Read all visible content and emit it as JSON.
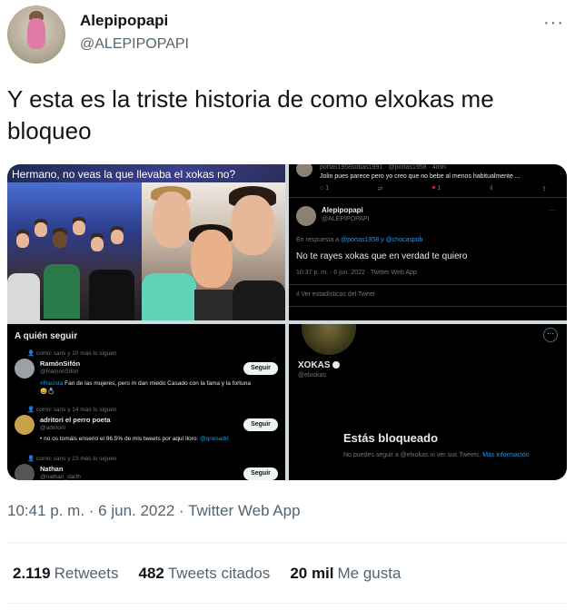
{
  "author": {
    "name": "Alepipopapi",
    "handle": "@ALEPIPOPAPI",
    "more_icon": "···"
  },
  "tweet": {
    "text": "Y esta es la triste historia de como elxokas me bloqueo"
  },
  "media": {
    "photo_caption": "Hermano, no veas la que llevaba el xokas no?",
    "reply_card": {
      "top_handle": "portas1958sobas1991 · @portas1958 · 4min",
      "top_text": "Jolin pues parece pero yo creo que no bebe  al menos habitualmente ...",
      "top_counts": [
        "1",
        "",
        "1",
        "",
        ""
      ],
      "name": "Alepipopapi",
      "handle": "@ALEPIPOPAPI",
      "reply_prefix": "En respuesta a",
      "reply_to": "@portas1958 y @chocaspob",
      "text": "No te rayes xokas que en verdad te quiero",
      "meta": "10:37 p. m. · 6 jun. 2022 · Twitter Web App",
      "stats_link": "Ver estadísticas del Tweet"
    },
    "who_to_follow": {
      "title": "A quién seguir",
      "items": [
        {
          "followed_by": "comic sans y 10 más lo siguen",
          "name": "RamónSifón",
          "handle": "@RamonSifon",
          "bio_tag": "#Racista",
          "bio": " Fan de las mujeres, pero m dan miedo Casado con la fama y la fortuna 😅💍",
          "button": "Seguir"
        },
        {
          "followed_by": "comic sans y 14 más lo siguen",
          "name": "adritori el perro poeta",
          "handle": "@adritorii",
          "bio": "• no os tomáis enserio el 96.5% de mis tweets por aquí lloro:",
          "bio_link": "@qnesadri",
          "button": "Seguir"
        },
        {
          "followed_by": "comic sans y 23 más lo siguen",
          "name": "Nathan",
          "handle": "@nathan_darth",
          "button": "Seguir"
        }
      ]
    },
    "blocked_profile": {
      "name": "XOKAS",
      "handle": "@elxokas",
      "options_icon": "···",
      "blocked_title": "Estás bloqueado",
      "blocked_text": "No puedes seguir a @elxokas ni ver sus Tweets.",
      "more_info": "Más información"
    }
  },
  "meta": "10:41 p. m. · 6 jun. 2022 · Twitter Web App",
  "stats": [
    {
      "count": "2.119",
      "label": "Retweets"
    },
    {
      "count": "482",
      "label": "Tweets citados"
    },
    {
      "count": "20 mil",
      "label": "Me gusta"
    }
  ],
  "colors": {
    "accent": "#1d9bf0",
    "text": "#0f1419",
    "secondary": "#536471",
    "dark_bg": "#000000"
  }
}
